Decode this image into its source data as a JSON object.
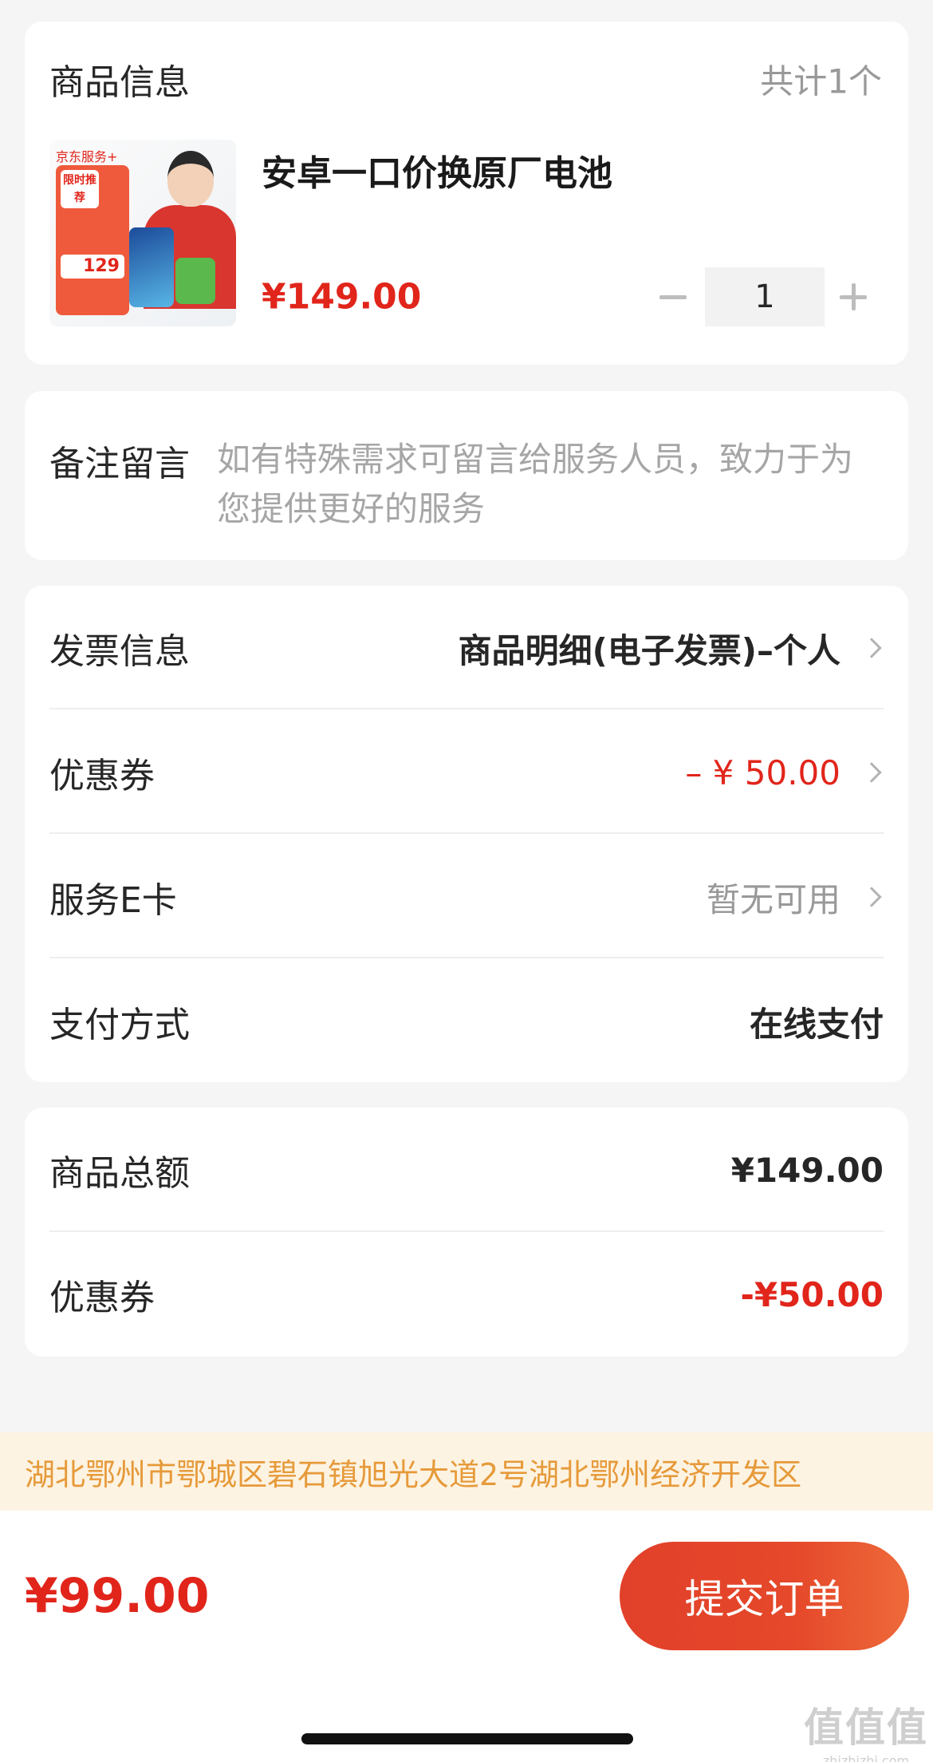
{
  "product": {
    "section_title": "商品信息",
    "count_label": "共计1个",
    "name": "安卓一口价换原厂电池",
    "price": "¥149.00",
    "quantity": "1",
    "image": {
      "brand_text": "京东服务+",
      "badge_text": "限时推荐",
      "promo_number": "129"
    }
  },
  "remark": {
    "label": "备注留言",
    "placeholder": "如有特殊需求可留言给服务人员，致力于为您提供更好的服务"
  },
  "options": {
    "invoice": {
      "label": "发票信息",
      "value": "商品明细(电子发票)–个人"
    },
    "coupon": {
      "label": "优惠券",
      "value": "– ¥ 50.00"
    },
    "ecard": {
      "label": "服务E卡",
      "value": "暂无可用"
    },
    "payment": {
      "label": "支付方式",
      "value": "在线支付"
    }
  },
  "totals": {
    "subtotal": {
      "label": "商品总额",
      "value": "¥149.00"
    },
    "coupon": {
      "label": "优惠券",
      "value": "-¥50.00"
    }
  },
  "address": "湖北鄂州市鄂城区碧石镇旭光大道2号湖北鄂州经济开发区",
  "footer": {
    "total": "¥99.00",
    "submit_label": "提交订单"
  },
  "watermark": {
    "main": "值值值",
    "sub": "zhizhizhi.com"
  },
  "colors": {
    "accent_red": "#e1251b",
    "address_bg": "#fdf3e2",
    "address_text": "#e69a3a",
    "page_bg": "#f5f5f5"
  },
  "icons": [
    "minus-icon",
    "plus-icon",
    "chevron-right-icon"
  ]
}
